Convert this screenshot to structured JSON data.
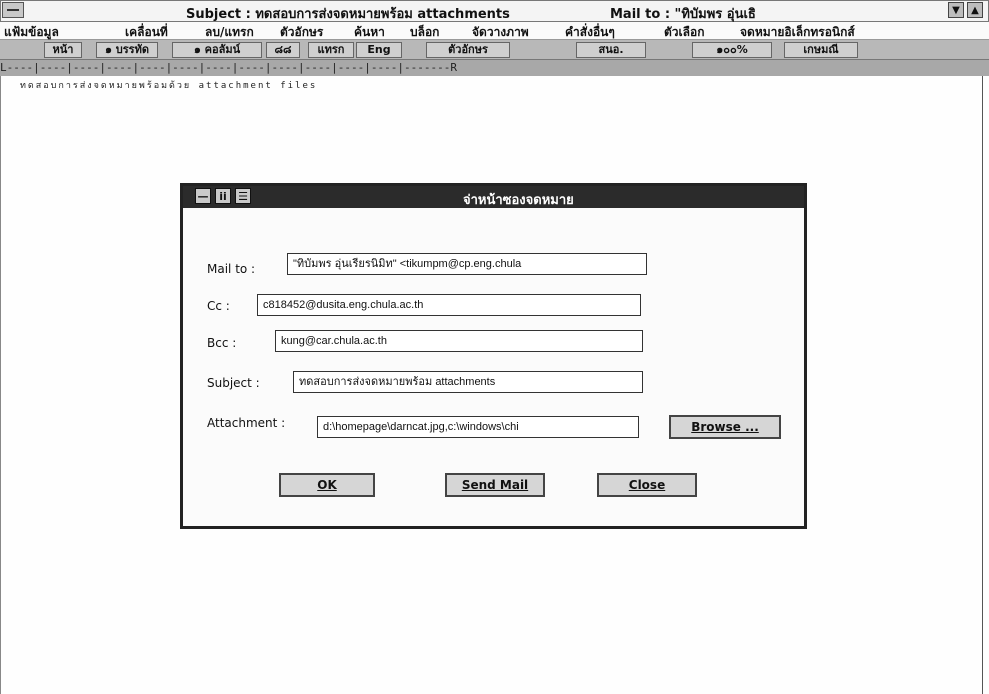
{
  "window": {
    "title_subject": "Subject : ทดสอบการส่งจดหมายพร้อม attachments",
    "title_mailto": "Mail to : \"ทิบัมพร อุ่นเธิ",
    "btn_down": "▼",
    "btn_up": "▲"
  },
  "menu": [
    "แฟ้มข้อมูล",
    "เคลื่อนที่",
    "ลบ/แทรก",
    "ตัวอักษร",
    "ค้นหา",
    "บล็อก",
    "จัดวางภาพ",
    "คำสั่งอื่นๆ",
    "ตัวเลือก",
    "จดหมายอิเล็กทรอนิกส์"
  ],
  "toolbar": [
    "หน้า",
    "๑ บรรทัด",
    "๑ คอลัมน์",
    "๘๘",
    "แทรก",
    "Eng",
    "ตัวอักษร",
    "สนอ.",
    "๑๐๐%",
    "เกษมณี"
  ],
  "ruler": "L----|----|----|----|----|----|----|----|----|----|----|----|-------R",
  "document": {
    "text": "ทดสอบการส่งจดหมายพร้อมด้วย attachment files"
  },
  "dialog": {
    "title": "จ่าหน้าซองจดหมาย",
    "icon_minimize": "—",
    "icon_a": "ii",
    "icon_b": "☰",
    "mail_to_label": "Mail to :",
    "mail_to_value": "\"ทิบัมพร อุ่นเรียรนิมิท\" <tikumpm@cp.eng.chula",
    "cc_label": "Cc :",
    "cc_value": "c818452@dusita.eng.chula.ac.th",
    "bcc_label": "Bcc :",
    "bcc_value": "kung@car.chula.ac.th",
    "subject_label": "Subject :",
    "subject_value": "ทดสอบการส่งจดหมายพร้อม attachments",
    "attachment_label": "Attachment :",
    "attachment_value": "d:\\homepage\\darncat.jpg,c:\\windows\\chi",
    "browse_label": "Browse ...",
    "ok_label": "OK",
    "send_label": "Send Mail",
    "close_label": "Close"
  }
}
